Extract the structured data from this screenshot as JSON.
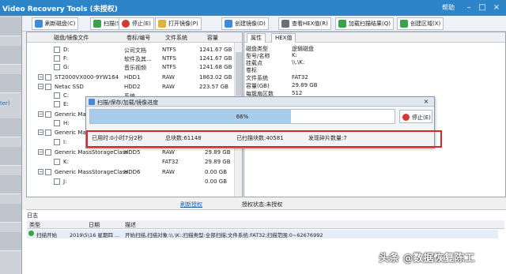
{
  "window": {
    "title": "Video Recovery Tools (未授权)",
    "help": "帮助"
  },
  "leftstrip": {
    "text": "ter)"
  },
  "toolbar": {
    "refresh": "刷新磁盘(C)",
    "scan": "扫描(S)",
    "stop": "停止(E)",
    "open_image": "打开镜像(P)",
    "create_image": "创建镜像(D)",
    "view_hex": "查看HEX值(R)",
    "load_scan": "加载扫描结果(Q)",
    "create_range": "创建区域(X)"
  },
  "disk_table": {
    "headers": [
      "磁盘/镜像文件",
      "卷标/编号",
      "文件系统",
      "容量"
    ],
    "rows": [
      {
        "name": "D:",
        "label": "公司文档",
        "fs": "NTFS",
        "size": "1241.67 GB"
      },
      {
        "name": "F:",
        "label": "软件及其...",
        "fs": "NTFS",
        "size": "1241.67 GB"
      },
      {
        "name": "G:",
        "label": "音乐视频",
        "fs": "NTFS",
        "size": "1241.68 GB"
      },
      {
        "name": "ST2000VX000-9YW164",
        "label": "HDD1",
        "fs": "RAW",
        "size": "1863.02 GB"
      },
      {
        "name": "Netac SSD",
        "label": "HDD2",
        "fs": "RAW",
        "size": "223.57 GB"
      },
      {
        "name": "C:",
        "label": "系统",
        "fs": "",
        "size": ""
      },
      {
        "name": "E:",
        "label": "",
        "fs": "",
        "size": ""
      },
      {
        "name": "Generic Mass",
        "label": "",
        "fs": "",
        "size": ""
      },
      {
        "name": "H:",
        "label": "",
        "fs": "",
        "size": ""
      },
      {
        "name": "Generic Mass",
        "label": "",
        "fs": "",
        "size": ""
      },
      {
        "name": "I:",
        "label": "",
        "fs": "",
        "size": ""
      },
      {
        "name": "Generic MassStorageClass",
        "label": "HDD5",
        "fs": "RAW",
        "size": "29.89 GB"
      },
      {
        "name": "K:",
        "label": "",
        "fs": "FAT32",
        "size": "29.89 GB"
      },
      {
        "name": "Generic MassStorageClass",
        "label": "HDD6",
        "fs": "RAW",
        "size": "0.00 GB"
      },
      {
        "name": "J:",
        "label": "",
        "fs": "",
        "size": "0.00 GB"
      }
    ]
  },
  "properties": {
    "tabs": [
      "属性",
      "HEX值"
    ],
    "rows": [
      {
        "k": "磁盘类型",
        "v": "逻辑磁盘"
      },
      {
        "k": "型号/名称",
        "v": "K:"
      },
      {
        "k": "挂载点",
        "v": "\\\\.\\K:"
      },
      {
        "k": "卷标",
        "v": ""
      },
      {
        "k": "文件系统",
        "v": "FAT32"
      },
      {
        "k": "容量(GB)",
        "v": "29.89 GB"
      },
      {
        "k": "每簇扇区数",
        "v": "512"
      }
    ]
  },
  "progress_dialog": {
    "title": "扫描/保存/加载/镜像进度",
    "percent_text": "66%",
    "percent": 66,
    "stop": "停止(E)",
    "elapsed": "已用时:0小时7分2秒",
    "total_blocks": "总块数:61148",
    "scanned_blocks": "已扫描块数:40581",
    "found_fragments": "发现碎片数量:7"
  },
  "linkbar": {
    "refresh_auth": "刷新授权",
    "auth_status": "授权状态:未授权"
  },
  "log": {
    "label": "日志",
    "headers": [
      "类型",
      "日期",
      "描述"
    ],
    "row": {
      "type": "扫描开始",
      "date": "2019\\5\\16 星期四 ...",
      "desc": "开始扫描,扫描对象:\\\\.\\K:;扫描类型:全部扫描;文件系统:FAT32;扫描范围:0~62676992"
    }
  },
  "watermark": "头条 @数据恢复陈工",
  "colors": {
    "titlebar": "#2e84c9",
    "highlight": "#e0252a",
    "progress": "#a8cdea"
  }
}
